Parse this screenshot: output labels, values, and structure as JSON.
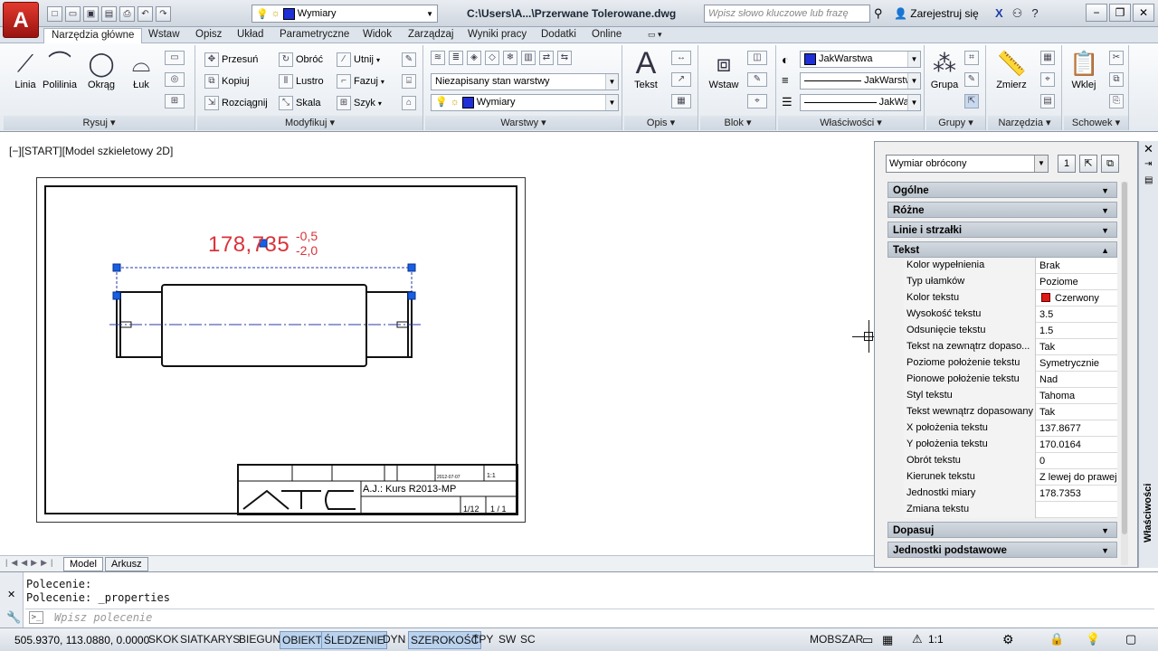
{
  "app": {
    "logo": "A",
    "doc_title": "C:\\Users\\A...\\Przerwane Tolerowane.dwg",
    "search_placeholder": "Wpisz słowo kluczowe lub frazę",
    "signin": "Zarejestruj się",
    "layer_quick": "Wymiary",
    "colors": {
      "layer_blue": "#1f2fd8",
      "dim_red": "#d9333b",
      "accent": "#b9d2ee"
    }
  },
  "tabs": [
    "Narzędzia główne",
    "Wstaw",
    "Opisz",
    "Układ",
    "Parametryczne",
    "Widok",
    "Zarządzaj",
    "Wyniki pracy",
    "Dodatki",
    "Online"
  ],
  "ribbon": {
    "rysuj": {
      "title": "Rysuj",
      "tools": [
        "Linia",
        "Polilinia",
        "Okrąg",
        "Łuk"
      ]
    },
    "modyfikuj": {
      "title": "Modyfikuj",
      "tools": [
        "Przesuń",
        "Obróć",
        "Utnij",
        "Kopiuj",
        "Lustro",
        "Fazuj",
        "Rozciągnij",
        "Skala",
        "Szyk"
      ]
    },
    "warstwy": {
      "title": "Warstwy",
      "state": "Niezapisany stan warstwy",
      "layer": "Wymiary"
    },
    "opis": {
      "title": "Opis",
      "tool": "Tekst"
    },
    "blok": {
      "title": "Blok",
      "tool": "Wstaw"
    },
    "wlasciwosci": {
      "title": "Właściwości",
      "color": "JakWarstwa",
      "linetype": "JakWarstw...",
      "lineweight": "JakWar..."
    },
    "grupy": {
      "title": "Grupy",
      "tool": "Grupa"
    },
    "narzedzia": {
      "title": "Narzędzia",
      "tool": "Zmierz"
    },
    "schowek": {
      "title": "Schowek",
      "tool": "Wklej"
    }
  },
  "viewport": {
    "label": "[−][START][Model szkieletowy 2D]"
  },
  "drawing": {
    "dim_main": "178,735",
    "tol_upper": "-0,5",
    "tol_lower": "-2,0",
    "title_main": "A.J.: Kurs R2013-MP",
    "sheet": "1/12",
    "count": "1 / 1",
    "scale": "1:1",
    "date": "2012-07-07",
    "company": "ATC"
  },
  "model_tabs": [
    "Model",
    "Arkusz"
  ],
  "properties": {
    "object_type": "Wymiar obrócony",
    "side_title": "Właściwości",
    "categories": [
      {
        "name": "Ogólne",
        "open": false
      },
      {
        "name": "Różne",
        "open": false
      },
      {
        "name": "Linie i strzałki",
        "open": false
      },
      {
        "name": "Tekst",
        "open": true
      }
    ],
    "text_rows": [
      {
        "name": "Kolor wypełnienia",
        "value": "Brak"
      },
      {
        "name": "Typ ułamków",
        "value": "Poziome"
      },
      {
        "name": "Kolor tekstu",
        "value": "Czerwony"
      },
      {
        "name": "Wysokość tekstu",
        "value": "3.5"
      },
      {
        "name": "Odsunięcie tekstu",
        "value": "1.5"
      },
      {
        "name": "Tekst na zewnątrz dopaso...",
        "value": "Tak"
      },
      {
        "name": "Poziome położenie tekstu",
        "value": "Symetrycznie"
      },
      {
        "name": "Pionowe położenie tekstu",
        "value": "Nad"
      },
      {
        "name": "Styl tekstu",
        "value": "Tahoma"
      },
      {
        "name": "Tekst wewnątrz dopasowany",
        "value": "Tak"
      },
      {
        "name": "X położenia tekstu",
        "value": "137.8677"
      },
      {
        "name": "Y położenia tekstu",
        "value": "170.0164"
      },
      {
        "name": "Obrót tekstu",
        "value": "0"
      },
      {
        "name": "Kierunek tekstu",
        "value": "Z lewej do prawej"
      },
      {
        "name": "Jednostki miary",
        "value": "178.7353"
      },
      {
        "name": "Zmiana tekstu",
        "value": ""
      }
    ],
    "after": [
      "Dopasuj",
      "Jednostki podstawowe"
    ]
  },
  "command": {
    "line1": "Polecenie:",
    "line2": "Polecenie: _properties",
    "placeholder": "Wpisz polecenie"
  },
  "status": {
    "coords": "505.9370, 113.0880, 0.0000",
    "buttons": [
      {
        "label": "SKOK",
        "on": false
      },
      {
        "label": "SIATKARYS",
        "on": false
      },
      {
        "label": "BIEGUN",
        "on": false
      },
      {
        "label": "OBIEKT",
        "on": true
      },
      {
        "label": "ŚLEDZENIE",
        "on": true
      },
      {
        "label": "DYN",
        "on": false
      },
      {
        "label": "SZEROKOŚĆ",
        "on": true
      },
      {
        "label": "TPY",
        "on": false
      },
      {
        "label": "SW",
        "on": false
      },
      {
        "label": "SC",
        "on": false
      }
    ],
    "space": "MODEL",
    "space2": "MOBSZAR",
    "scale": "1:1"
  }
}
